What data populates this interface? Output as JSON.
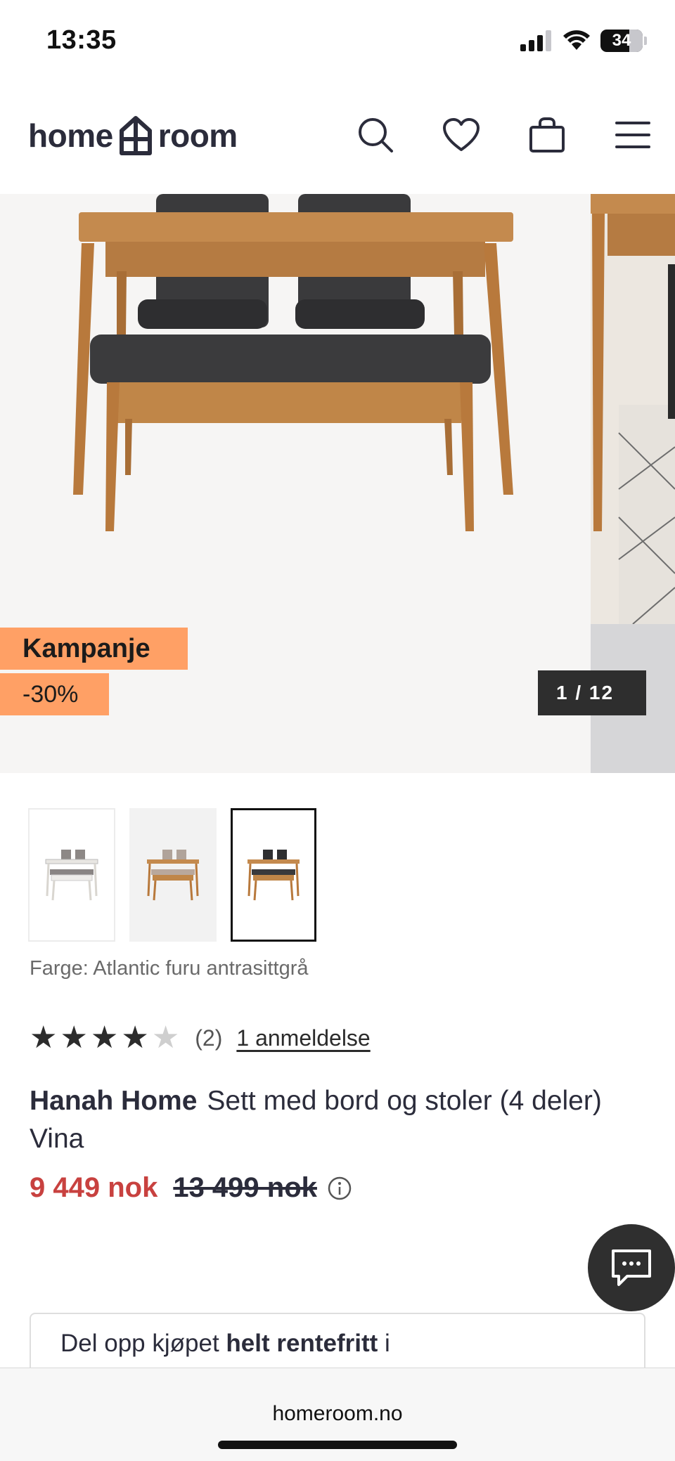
{
  "status": {
    "time": "13:35",
    "battery": "34"
  },
  "header": {
    "logo_left": "home",
    "logo_right": "room",
    "icons": [
      "search-icon",
      "heart-icon",
      "shopping-bag-icon",
      "menu-icon"
    ]
  },
  "gallery": {
    "campaign_badge": "Kampanje",
    "discount_badge": "-30%",
    "counter": "1 / 12"
  },
  "thumbnails": [
    {
      "variant": "white",
      "selected": false
    },
    {
      "variant": "beige",
      "selected": false
    },
    {
      "variant": "antrasitt",
      "selected": true
    }
  ],
  "product": {
    "color_label": "Farge: Atlantic furu antrasittgrå",
    "rating": {
      "value": 4,
      "max": 5,
      "count": "(2)",
      "reviews_link": "1 anmeldelse"
    },
    "brand": "Hanah Home",
    "name": "Sett med bord og stoler (4 deler) Vina",
    "price_now": "9 449 nok",
    "price_old": "13 499 nok"
  },
  "financing": {
    "text_prefix": "Del opp kjøpet ",
    "text_bold": "helt rentefritt",
    "text_suffix": " i"
  },
  "browser": {
    "url": "homeroom.no"
  },
  "colors": {
    "accent_orange": "#ffa065",
    "sale_red": "#c8413f",
    "dark": "#2b2c3b"
  }
}
